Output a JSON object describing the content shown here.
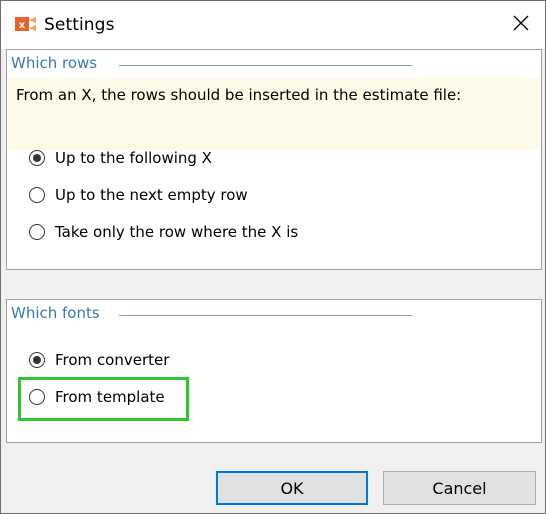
{
  "window": {
    "title": "Settings",
    "icon": "app-icon",
    "close_icon": "close-icon",
    "accent_color": "#0078d7",
    "highlight_color": "#2ec82e"
  },
  "rows_group": {
    "title": "Which rows",
    "description": "From an X, the rows should be inserted in the estimate file:",
    "options": [
      {
        "label": "Up to the following X",
        "checked": true
      },
      {
        "label": "Up to the next empty row",
        "checked": false
      },
      {
        "label": "Take only the row where the X is",
        "checked": false
      }
    ]
  },
  "fonts_group": {
    "title": "Which fonts",
    "options": [
      {
        "label": "From converter",
        "checked": true
      },
      {
        "label": "From template",
        "checked": false
      }
    ]
  },
  "buttons": {
    "ok": "OK",
    "cancel": "Cancel"
  }
}
